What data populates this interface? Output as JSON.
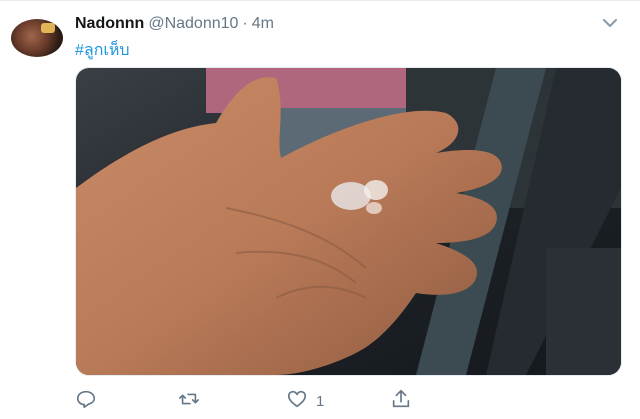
{
  "tweet": {
    "display_name": "Nadonnn",
    "handle": "@Nadonn10",
    "separator": "·",
    "time": "4m",
    "text": "#ลูกเห็บ",
    "likes": "1"
  },
  "icons": {
    "caret": "chevron-down-icon",
    "reply": "reply-icon",
    "retweet": "retweet-icon",
    "like": "heart-icon",
    "share": "share-icon"
  },
  "colors": {
    "link": "#1b95e0",
    "muted": "#657786",
    "text": "#14171a"
  }
}
